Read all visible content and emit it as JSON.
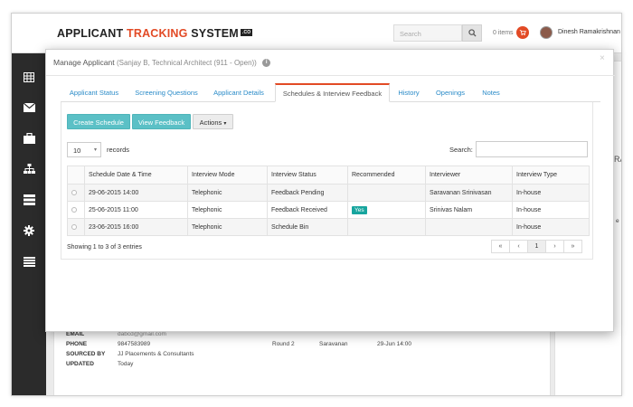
{
  "app": {
    "title_part1": "APPLICANT ",
    "title_part2": "TRACKING",
    "title_part3": " SYSTEM",
    "title_badge": ".CO",
    "search_placeholder": "Search",
    "cart_label": "0 items",
    "user_name": "Dinesh Ramakrishnan"
  },
  "sidebar": {
    "items": [
      {
        "icon": "grid-icon"
      },
      {
        "icon": "mail-icon"
      },
      {
        "icon": "briefcase-icon"
      },
      {
        "icon": "org-chart-icon"
      },
      {
        "icon": "server-icon"
      },
      {
        "icon": "gear-icon"
      },
      {
        "icon": "list-icon"
      }
    ]
  },
  "background": {
    "email_label": "EMAIL",
    "email_value": "dabcd@gmail.com",
    "phone_label": "PHONE",
    "phone_value": "9847583989",
    "sourced_label": "SOURCED BY",
    "sourced_value": "JJ Placements & Consultants",
    "updated_label": "UPDATED",
    "updated_value": "Today",
    "round": "Round 2",
    "interviewer": "Saravanan",
    "date": "29-Jun 14:00",
    "right_letters_1": "RA",
    "right_letters_2": "e"
  },
  "modal": {
    "title": "Manage Applicant",
    "subtitle": "(Sanjay B, Technical Architect (911 - Open))",
    "close": "×",
    "tabs": [
      {
        "label": "Applicant Status"
      },
      {
        "label": "Screening Questions"
      },
      {
        "label": "Applicant Details"
      },
      {
        "label": "Schedules & Interview Feedback",
        "active": true
      },
      {
        "label": "History"
      },
      {
        "label": "Openings"
      },
      {
        "label": "Notes"
      }
    ],
    "buttons": {
      "create": "Create Schedule",
      "feedback": "View Feedback",
      "actions": "Actions"
    },
    "length_value": "10",
    "length_label": "records",
    "search_label": "Search:",
    "table": {
      "headers": [
        "Schedule Date & Time",
        "Interview Mode",
        "Interview Status",
        "Recommended",
        "Interviewer",
        "Interview Type"
      ],
      "rows": [
        {
          "date": "29-06-2015 14:00",
          "mode": "Telephonic",
          "status": "Feedback Pending",
          "recommended": "",
          "interviewer": "Saravanan Srinivasan",
          "type": "In-house"
        },
        {
          "date": "25-06-2015 11:00",
          "mode": "Telephonic",
          "status": "Feedback Received",
          "recommended": "Yes",
          "interviewer": "Srinivas Nalam",
          "type": "In-house"
        },
        {
          "date": "23-06-2015 16:00",
          "mode": "Telephonic",
          "status": "Schedule Bin",
          "recommended": "",
          "interviewer": "",
          "type": "In-house"
        }
      ]
    },
    "showing_text": "Showing 1 to 3 of 3 entries",
    "pager": {
      "first": "«",
      "prev": "‹",
      "page": "1",
      "next": "›",
      "last": "»"
    }
  },
  "colors": {
    "accent": "#e24a25",
    "teal": "#5bc0c6",
    "link": "#2a8bc8",
    "badge": "#17a59e",
    "sidebar": "#2b2b2b"
  }
}
